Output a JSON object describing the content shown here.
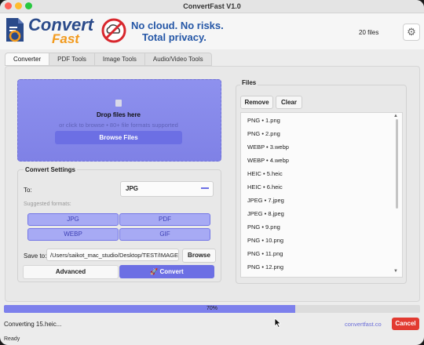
{
  "window": {
    "title": "ConvertFast V1.0"
  },
  "header": {
    "logo_line1": "Convert",
    "logo_line2": "Fast",
    "tagline_line1": "No cloud. No risks.",
    "tagline_line2": "Total privacy.",
    "file_count": "20 files",
    "brand_blue": "#2a4a8a",
    "brand_orange": "#f29a1d"
  },
  "tabs": [
    {
      "label": "Converter",
      "active": true
    },
    {
      "label": "PDF Tools"
    },
    {
      "label": "Image Tools"
    },
    {
      "label": "Audio/Video Tools"
    }
  ],
  "dropzone": {
    "title": "Drop files here",
    "subtitle": "or click to browse • 80+ file formats supported",
    "browse_label": "Browse Files"
  },
  "settings": {
    "title": "Convert Settings",
    "to_label": "To:",
    "to_value": "JPG",
    "suggested_label": "Suggested formats:",
    "formats": [
      "JPG",
      "PDF",
      "WEBP",
      "GIF"
    ],
    "save_to_label": "Save to:",
    "save_path": "/Users/saikot_mac_studio/Desktop/TEST/IMAGES",
    "browse_label": "Browse",
    "advanced_label": "Advanced",
    "convert_label": "🚀 Convert"
  },
  "files": {
    "title": "Files",
    "remove_label": "Remove",
    "clear_label": "Clear",
    "items": [
      "PNG • 1.png",
      "PNG • 2.png",
      "WEBP • 3.webp",
      "WEBP • 4.webp",
      "HEIC • 5.heic",
      "HEIC • 6.heic",
      "JPEG • 7.jpeg",
      "JPEG • 8.jpeg",
      "PNG • 9.png",
      "PNG • 10.png",
      "PNG • 11.png",
      "PNG • 12.png"
    ]
  },
  "progress": {
    "value": 70,
    "label": "70%"
  },
  "status": {
    "message": "Converting 15.heic...",
    "ready": "Ready",
    "link": "convertfast.co",
    "cancel_label": "Cancel"
  },
  "colors": {
    "accent": "#6c6fe4",
    "danger": "#e23a31"
  }
}
